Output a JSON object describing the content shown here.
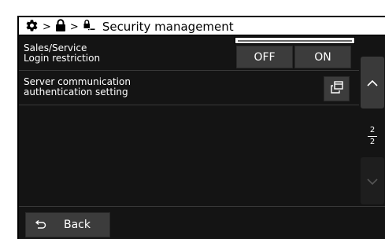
{
  "header": {
    "crumb_sep_1": ">",
    "crumb_sep_2": ">",
    "title": "Security management"
  },
  "rows": [
    {
      "label": "Sales/Service\nLogin restriction",
      "options": [
        "OFF",
        "ON"
      ],
      "selected": "OFF"
    },
    {
      "label": "Server communication\nauthentication setting",
      "icon": "window-open-icon"
    }
  ],
  "scroll": {
    "page_current": "2",
    "page_total": "2"
  },
  "footer": {
    "back_label": "Back"
  },
  "colors": {
    "background": "#141414",
    "button": "#3c3c3c",
    "title_bg": "#ffffff",
    "text": "#ffffff"
  }
}
